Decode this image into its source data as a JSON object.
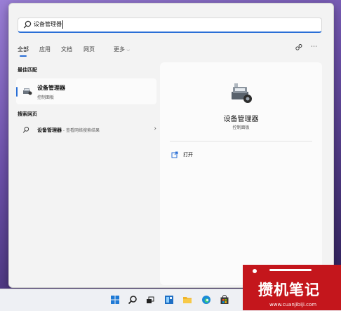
{
  "search": {
    "query": "设备管理器"
  },
  "tabs": [
    {
      "label": "全部",
      "active": true
    },
    {
      "label": "应用",
      "active": false
    },
    {
      "label": "文档",
      "active": false
    },
    {
      "label": "网页",
      "active": false
    },
    {
      "label": "更多",
      "active": false
    }
  ],
  "header_icons": [
    "share-people-icon",
    "more-ellipsis-icon"
  ],
  "sections": {
    "best_match": "最佳匹配",
    "web_search": "搜索网页"
  },
  "best_match": {
    "title": "设备管理器",
    "subtitle": "控制面板",
    "icon": "device-manager-icon"
  },
  "web_result": {
    "title": "设备管理器",
    "suffix": " - 查看网络搜索结果"
  },
  "detail": {
    "name": "设备管理器",
    "category": "控制面板",
    "open_label": "打开"
  },
  "taskbar": {
    "icons": [
      "windows-start-icon",
      "search-icon",
      "task-view-icon",
      "widgets-icon",
      "file-explorer-icon",
      "edge-icon",
      "store-icon"
    ]
  },
  "watermark": {
    "brand": "攒机笔记",
    "url": "www.cuanjibiji.com"
  },
  "colors": {
    "accent": "#2a6fd6",
    "watermark": "#c4161c"
  }
}
